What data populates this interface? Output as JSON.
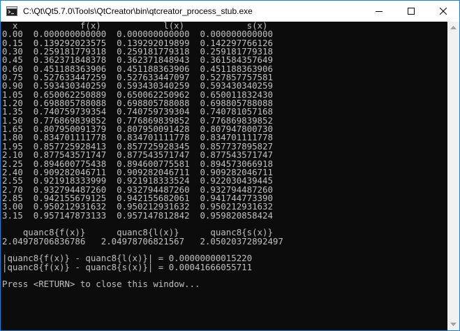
{
  "window": {
    "title": "C:\\Qt\\Qt5.7.0\\Tools\\QtCreator\\bin\\qtcreator_process_stub.exe",
    "controls": [
      "minimize-icon",
      "maximize-icon",
      "close-icon"
    ],
    "icon": "console-app-icon"
  },
  "console": {
    "lines": [
      "  x            f(x)            l(x)            s(x)",
      "0.00  0.000000000000  0.000000000000  0.000000000000",
      "0.15  0.139292023575  0.139292019899  0.142297766126",
      "0.30  0.259181779318  0.259181779318  0.259181779318",
      "0.45  0.362371848378  0.362371848943  0.361584357649",
      "0.60  0.451188363906  0.451188363906  0.451188363906",
      "0.75  0.527633447259  0.527633447097  0.527857757581",
      "0.90  0.593430340259  0.593430340259  0.593430340259",
      "1.05  0.650062250889  0.650062250962  0.650011832430",
      "1.20  0.698805788088  0.698805788088  0.698805788088",
      "1.35  0.740759739354  0.740759739304  0.740781057168",
      "1.50  0.776869839852  0.776869839852  0.776869839852",
      "1.65  0.807950091379  0.807950091428  0.807947800730",
      "1.80  0.834701111778  0.834701111778  0.834701111778",
      "1.95  0.857725928413  0.857725928345  0.857737895827",
      "2.10  0.877543571747  0.877543571747  0.877543571747",
      "2.25  0.894600775438  0.894600775581  0.894573066918",
      "2.40  0.909282046711  0.909282046711  0.909282046711",
      "2.55  0.921918333999  0.921918333524  0.922030439445",
      "2.70  0.932794487260  0.932794487260  0.932794487260",
      "2.85  0.942155679125  0.942155682061  0.941744773390",
      "3.00  0.950212931632  0.950212931632  0.950212931632",
      "3.15  0.957147873133  0.957147812842  0.959820858424",
      "",
      "    quanc8{f(x)}      quanc8{l(x)}      quanc8{s(x)}",
      "2.04978706836786   2.04978706821567   2.05020372892497",
      "",
      "|quanc8{f(x)} - quanc8{l(x)}| = 0.00000000015220",
      "|quanc8{f(x)} - quanc8{s(x)}| = 0.00041666055711",
      "",
      "Press <RETURN> to close this window..."
    ]
  },
  "colors": {
    "console_bg": "#0c0c0c",
    "console_fg": "#c0c0c0",
    "titlebar_bg": "#ffffff",
    "border": "#1c7fd6"
  }
}
